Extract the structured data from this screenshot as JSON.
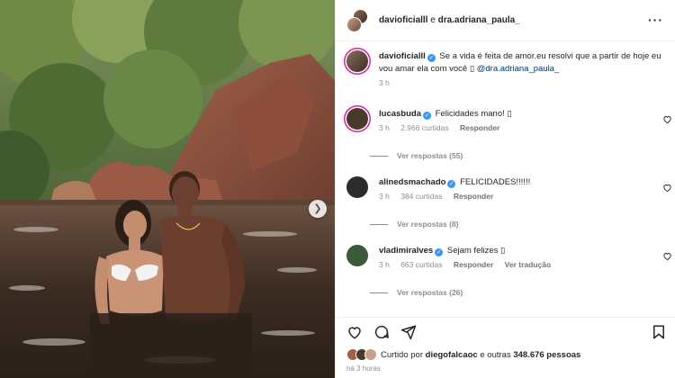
{
  "header": {
    "user1": "davioficialll",
    "joiner": "e",
    "user2": "dra.adriana_paula_"
  },
  "caption": {
    "username": "davioficialll",
    "text": "Se a vida é feita de amor.eu resolvi que a partir de hoje eu vou amar ela com você",
    "emoji": "▯",
    "mention": "@dra.adriana_paula_",
    "time": "3 h"
  },
  "comments": [
    {
      "username": "lucasbuda",
      "text": "Felicidades mano! ▯",
      "time": "3 h",
      "likes": "2.966 curtidas",
      "reply_label": "Responder",
      "translate_label": "",
      "view_replies": "Ver respostas (55)",
      "avatar_color": "#4a3a2a"
    },
    {
      "username": "alinedsmachado",
      "text": "FELICIDADES!!!!!!",
      "time": "3 h",
      "likes": "384 curtidas",
      "reply_label": "Responder",
      "translate_label": "",
      "view_replies": "Ver respostas (8)",
      "avatar_color": "#2b2b2b"
    },
    {
      "username": "vladimiralves",
      "text": "Sejam felizes ▯",
      "time": "3 h",
      "likes": "663 curtidas",
      "reply_label": "Responder",
      "translate_label": "Ver tradução",
      "view_replies": "Ver respostas (26)",
      "avatar_color": "#3b5a3a"
    }
  ],
  "likes": {
    "prefix": "Curtido por",
    "user": "diegofalcaoc",
    "middle": "e outras",
    "count": "348.676 pessoas"
  },
  "post_time": "há 3 horas",
  "icons": {
    "more": "more-options-icon",
    "like": "heart-icon",
    "comment": "comment-icon",
    "share": "share-icon",
    "save": "bookmark-icon",
    "carousel": "chevron-right-icon",
    "verified": "verified-badge-icon"
  },
  "colors": {
    "verified": "#3897f0",
    "story_ring": "#d6249f",
    "mention": "#00376b",
    "meta": "#8e8e8e"
  }
}
